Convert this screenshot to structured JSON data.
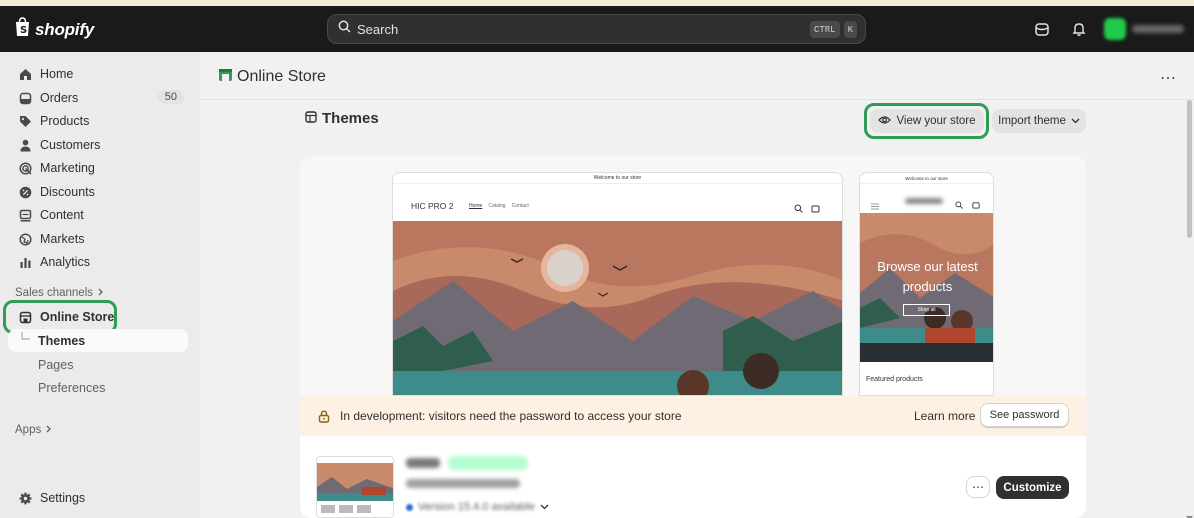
{
  "topbar": {
    "brand": "shopify",
    "search_placeholder": "Search",
    "shortcut_keys": [
      "CTRL",
      "K"
    ],
    "icons": [
      "store-icon",
      "bell-icon"
    ]
  },
  "sidebar": {
    "items": [
      {
        "label": "Home",
        "icon": "home-icon"
      },
      {
        "label": "Orders",
        "icon": "orders-icon",
        "badge": "50"
      },
      {
        "label": "Products",
        "icon": "tag-icon"
      },
      {
        "label": "Customers",
        "icon": "person-icon"
      },
      {
        "label": "Marketing",
        "icon": "target-icon"
      },
      {
        "label": "Discounts",
        "icon": "discount-icon"
      },
      {
        "label": "Content",
        "icon": "content-icon"
      },
      {
        "label": "Markets",
        "icon": "globe-icon"
      },
      {
        "label": "Analytics",
        "icon": "bar-chart-icon"
      }
    ],
    "sales_channels_label": "Sales channels",
    "online_store_label": "Online Store",
    "sub_items": [
      "Themes",
      "Pages",
      "Preferences"
    ],
    "apps_label": "Apps",
    "settings_label": "Settings"
  },
  "header": {
    "title": "Online Store",
    "more": "⋯"
  },
  "themes": {
    "title": "Themes",
    "view_store_label": "View your store",
    "import_theme_label": "Import theme"
  },
  "preview": {
    "welcome": "Welcome to our store",
    "store_name": "HIC PRO 2",
    "nav": [
      "Home",
      "Catalog",
      "Contact"
    ],
    "mobile_hero": "Browse our latest products",
    "mobile_hero_button": "Shop all",
    "featured": "Featured products"
  },
  "banner": {
    "message": "In development: visitors need the password to access your store",
    "learn_more": "Learn more",
    "see_password": "See password"
  },
  "theme_row": {
    "version": "Version 15.4.0 available",
    "customize_label": "Customize",
    "more_label": "⋯"
  },
  "colors": {
    "topbar": "#1a1a1a",
    "highlight": "#2e9d57",
    "primary_button": "#303030",
    "banner": "#fdf1e4"
  }
}
